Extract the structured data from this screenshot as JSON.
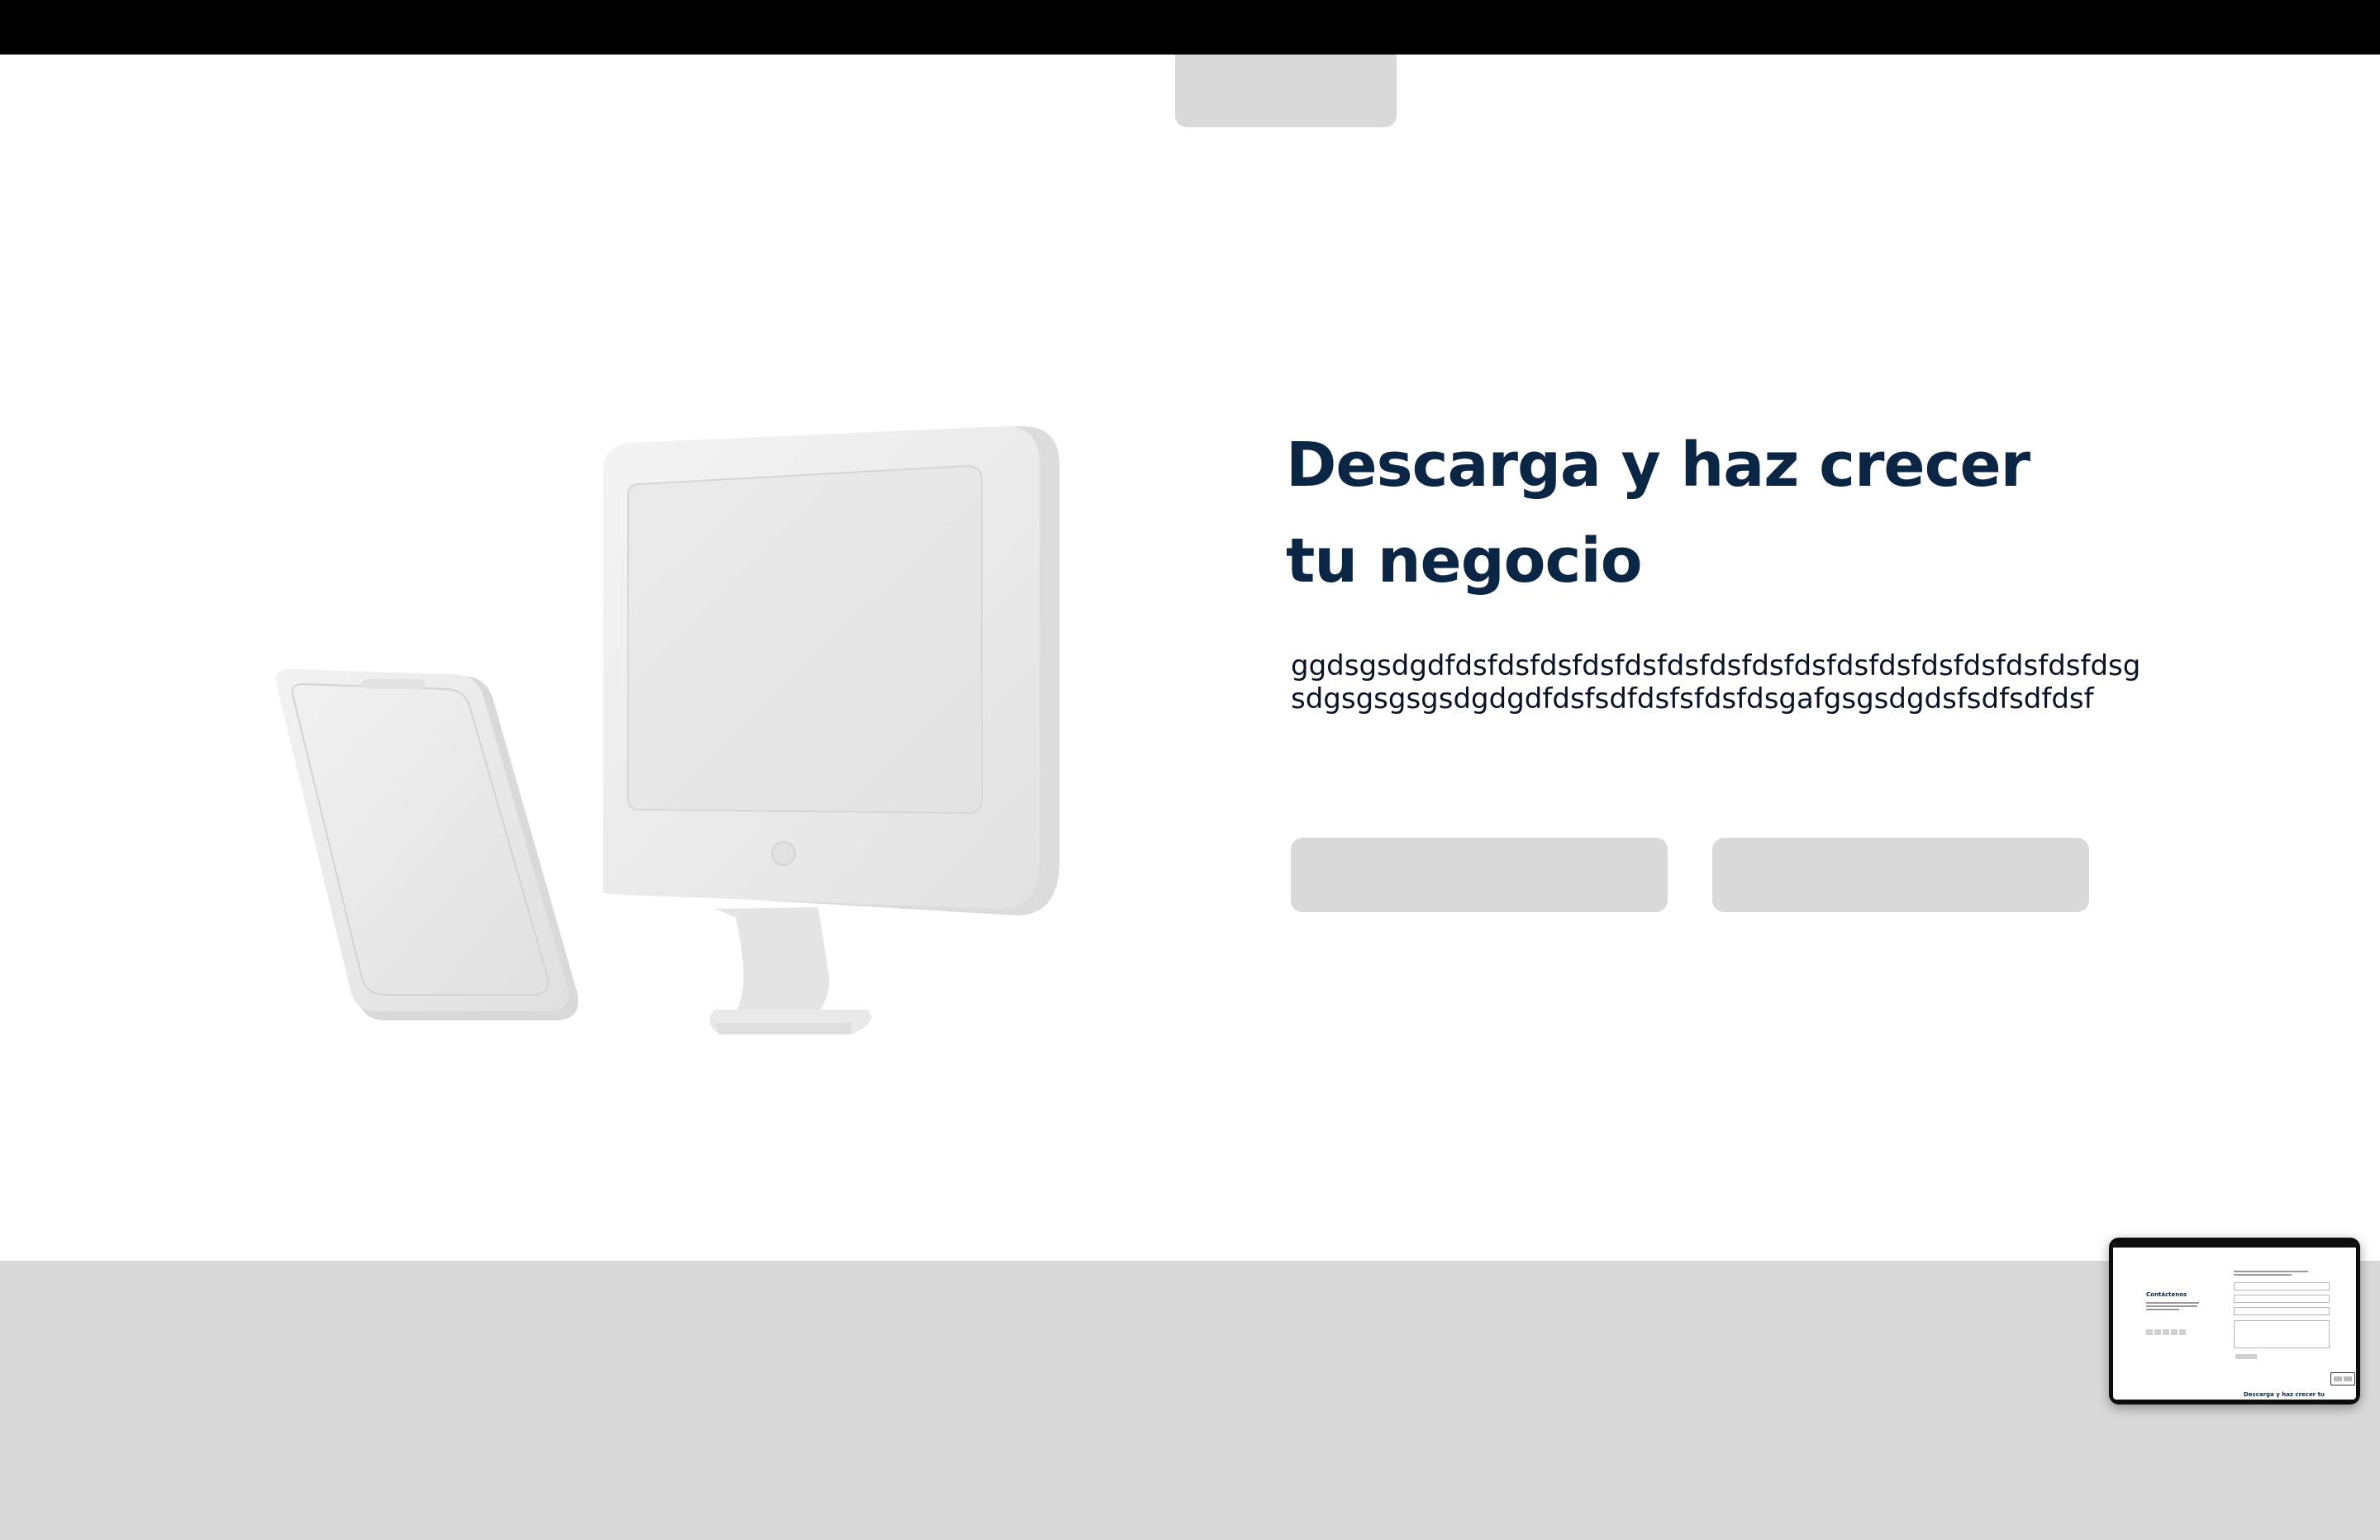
{
  "hero": {
    "title": "Descarga y haz crecer tu negocio",
    "description": "ggdsgsdgdfdsfdsfdsfdsfdsfdsfdsfdsfdsfdsfdsfdsfdsfdsfdsfdsgsdgsgsgsgsdgdgdfdsfsdfdsfsfdsfdsgafgsgsdgdsfsdfsdfdsf"
  },
  "preview": {
    "heading": "Contáctenos",
    "subheading": "Descarga y haz crecer tu"
  },
  "colors": {
    "topbar": "#000000",
    "placeholder": "#d9d9d9",
    "headline": "#0b2545",
    "body_text": "#0b1424",
    "footer": "#d9d9d9"
  }
}
